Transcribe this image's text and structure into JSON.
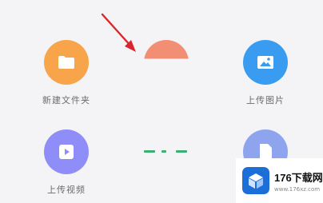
{
  "tiles": {
    "new_folder": {
      "label": "新建文件夹",
      "icon": "folder-icon",
      "color": "#f8a44a"
    },
    "upload_image": {
      "label": "上传图片",
      "icon": "image-icon",
      "color": "#3a9cf0"
    },
    "upload_video": {
      "label": "上传视频",
      "icon": "play-icon",
      "color": "#8f8ef8"
    },
    "document": {
      "label": "",
      "icon": "document-icon",
      "color": "#8fa4ee"
    }
  },
  "annotation": {
    "icon": "red-arrow-icon",
    "color": "#d9252b"
  },
  "watermark": {
    "title": "176下载网",
    "subtitle": "www.176xz.com"
  }
}
